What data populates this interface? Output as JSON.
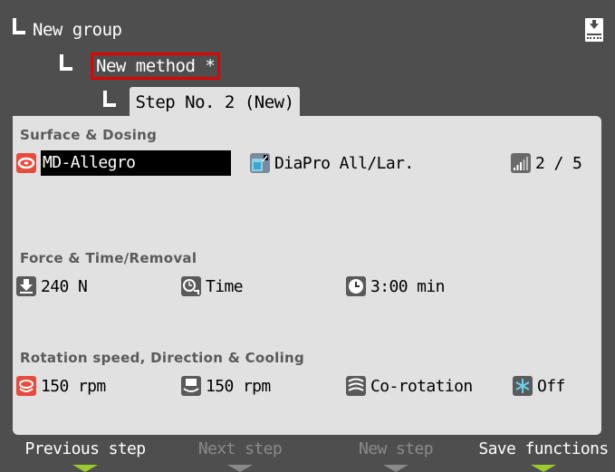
{
  "tree": {
    "group": "New group",
    "method": "New method *",
    "step_tab": "Step No. 2 (New)"
  },
  "icons": {
    "save": "save-download-icon",
    "surface": "polishing-disc-icon",
    "dosing": "suspension-bottle-icon",
    "level": "signal-level-icon",
    "force": "force-download-icon",
    "removal_mode": "time-mode-icon",
    "time": "clock-icon",
    "disc_speed": "disc-rotation-icon",
    "head_speed": "holder-rotation-icon",
    "direction": "rotation-direction-icon",
    "cooling": "snowflake-icon"
  },
  "sections": {
    "surface_dosing": {
      "title": "Surface & Dosing",
      "surface": "MD-Allegro",
      "dosing": "DiaPro All/Lar.",
      "level": "2 / 5"
    },
    "force_time": {
      "title": "Force & Time/Removal",
      "force": "240 N",
      "mode": "Time",
      "time": "3:00 min"
    },
    "rotation": {
      "title": "Rotation speed, Direction & Cooling",
      "disc_speed": "150 rpm",
      "head_speed": "150 rpm",
      "direction": "Co-rotation",
      "cooling": "Off"
    }
  },
  "footer": {
    "previous": "Previous step",
    "next": "Next step",
    "new": "New step",
    "save": "Save functions"
  },
  "colors": {
    "background": "#4e4e4e",
    "panel": "#e1e1e1",
    "highlight_border": "#e60000",
    "softkey_active": "#9ccc2c",
    "softkey_inactive": "#8a8a8a"
  }
}
